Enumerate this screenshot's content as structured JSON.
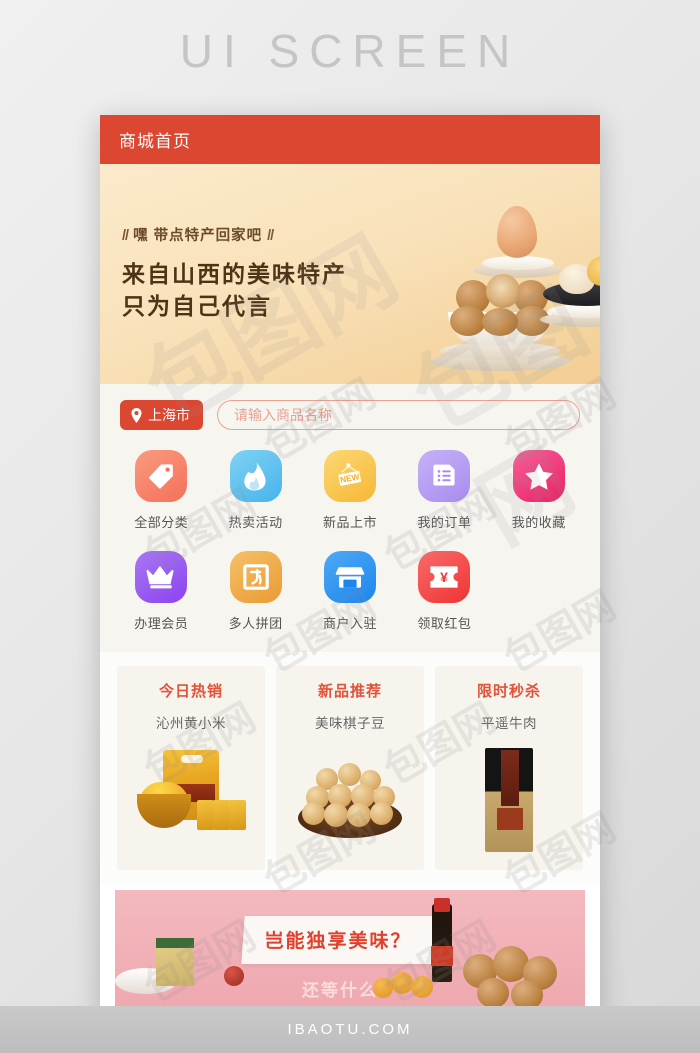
{
  "page": {
    "title": "UI SCREEN",
    "footer": "IBAOTU.COM",
    "watermark": "包图网"
  },
  "navbar": {
    "title": "商城首页"
  },
  "hero": {
    "kicker_left": "//",
    "kicker": "嘿 带点特产回家吧",
    "kicker_right": "//",
    "headline_line1": "来自山西的美味特产",
    "headline_line2": "只为自己代言"
  },
  "search": {
    "city": "上海市",
    "pin_icon": "location-pin-icon",
    "placeholder": "请输入商品名称",
    "value": ""
  },
  "grid": {
    "row1": [
      {
        "label": "全部分类",
        "icon": "tag-icon",
        "color1": "#fa9b7e",
        "color2": "#f4705a"
      },
      {
        "label": "热卖活动",
        "icon": "flame-icon",
        "color1": "#7fd2f4",
        "color2": "#47b3ec"
      },
      {
        "label": "新品上市",
        "icon": "new-sign-icon",
        "color1": "#fcd873",
        "color2": "#f6b737"
      },
      {
        "label": "我的订单",
        "icon": "order-list-icon",
        "color1": "#c6b2f7",
        "color2": "#a98bf0"
      },
      {
        "label": "我的收藏",
        "icon": "star-icon",
        "color1": "#f75f9a",
        "color2": "#ea1f63"
      }
    ],
    "row2": [
      {
        "label": "办理会员",
        "icon": "crown-icon",
        "color1": "#a977f5",
        "color2": "#8b43ef"
      },
      {
        "label": "多人拼团",
        "icon": "group-buy-icon",
        "color1": "#f6c068",
        "color2": "#e99b34"
      },
      {
        "label": "商户入驻",
        "icon": "shop-icon",
        "color1": "#4fa8f5",
        "color2": "#1c86ee"
      },
      {
        "label": "领取红包",
        "icon": "coupon-yuan-icon",
        "color1": "#fa6a6a",
        "color2": "#ef3434"
      }
    ]
  },
  "cards": [
    {
      "title": "今日热销",
      "subtitle": "沁州黄小米",
      "image": "millet-product-image"
    },
    {
      "title": "新品推荐",
      "subtitle": "美味棋子豆",
      "image": "dough-balls-product-image"
    },
    {
      "title": "限时秒杀",
      "subtitle": "平遥牛肉",
      "image": "beef-box-product-image"
    }
  ],
  "promo": {
    "headline": "岂能独享美味？",
    "subline": "还等什么"
  },
  "colors": {
    "brand_red": "#dc4732",
    "card_title_red": "#e2533b",
    "promo_pink": "#f0aab1",
    "hero_cream": "#f9e2bb"
  }
}
